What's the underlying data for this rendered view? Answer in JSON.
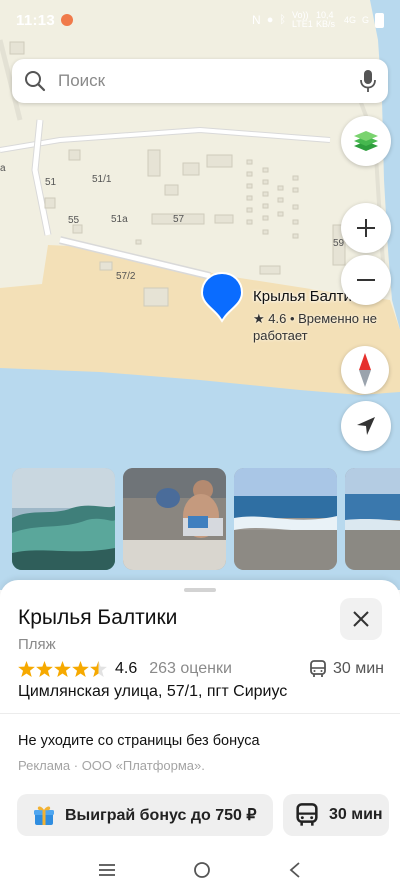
{
  "status_bar": {
    "time": "11:13",
    "network_1": "Vo)) LTE1",
    "speed": "10,4 KB/s",
    "network_2": "4G",
    "network_3": "G"
  },
  "search": {
    "placeholder": "Поиск"
  },
  "map": {
    "labels": [
      "51",
      "51/1",
      "55",
      "51a",
      "57",
      "59",
      "57/2",
      "a"
    ]
  },
  "place_marker": {
    "title": "Крылья Балтики",
    "rating_line": "★ 4.6 • Временно не работает"
  },
  "card": {
    "title": "Крылья Балтики",
    "category": "Пляж",
    "rating_value": "4.6",
    "reviews": "263 оценки",
    "transit_time": "30 мин",
    "address": "Цимлянская улица, 57/1, пгт Сириус",
    "ad_text": "Не уходите со страницы без бонуса",
    "ad_source": "Реклама · ООО «Платформа».",
    "bonus_button": "Выиграй бонус до 750 ₽",
    "route_button": "30 мин"
  },
  "rating": {
    "stars": 4.6,
    "max": 5
  },
  "icons": {
    "search": "search-icon",
    "mic": "microphone-icon",
    "layers": "layers-icon",
    "zoom_in": "plus-icon",
    "zoom_out": "minus-icon",
    "compass": "compass-icon",
    "locate": "navigation-arrow-icon",
    "close": "close-icon",
    "bus": "bus-icon",
    "gift": "gift-icon"
  },
  "colors": {
    "marker": "#0a6cff",
    "star": "#f6a900",
    "sea": "#b8d9ee",
    "beach": "#f3e0b7",
    "land": "#f1efe1"
  }
}
